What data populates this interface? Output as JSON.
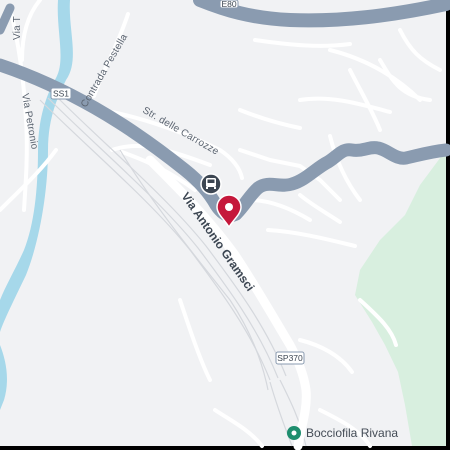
{
  "map": {
    "roads": {
      "via_t": "Via T",
      "via_petronio": "Via Petronio",
      "contrada_pestella": "Contrada Pestella",
      "str_delle_carrozze": "Str. delle Carrozze",
      "via_antonio_gramsci": "Via Antonio Gramsci"
    },
    "shields": {
      "ss1": "SS1",
      "sp370": "SP370",
      "top": "E80"
    },
    "poi": {
      "label": "Bocciofila Rivana",
      "icon": "park-marker-icon",
      "color": "#1e8e6e"
    },
    "pin": {
      "icon": "location-pin-icon",
      "color": "#c5183b"
    },
    "transit": {
      "icon": "bus-stop-icon"
    },
    "colors": {
      "land": "#f1f2f4",
      "water": "#a6d8ea",
      "green": "#d8efdf",
      "major_road": "#8a9bb0",
      "minor_road": "#ffffff"
    }
  }
}
